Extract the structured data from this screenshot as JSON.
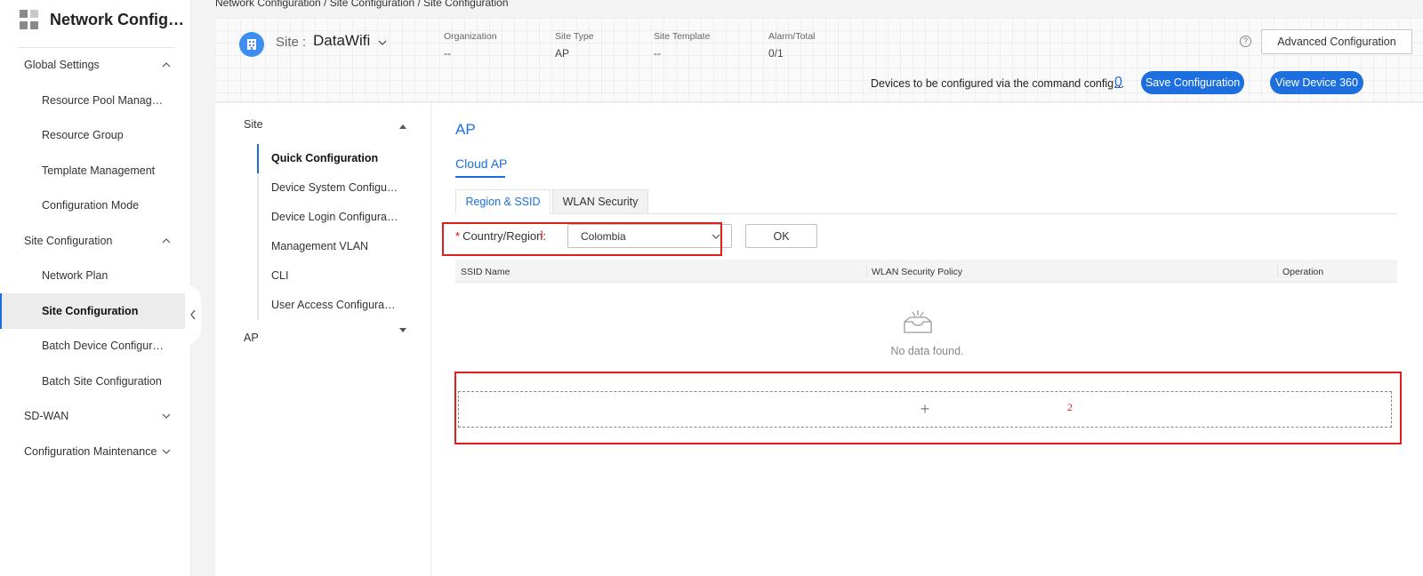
{
  "sidebar": {
    "title": "Network Config…",
    "items": [
      {
        "label": "Global Settings"
      },
      {
        "label": "Resource Pool Manag…"
      },
      {
        "label": "Resource Group"
      },
      {
        "label": "Template Management"
      },
      {
        "label": "Configuration Mode"
      },
      {
        "label": "Site Configuration"
      },
      {
        "label": "Network Plan"
      },
      {
        "label": "Site Configuration"
      },
      {
        "label": "Batch Device Configur…"
      },
      {
        "label": "Batch Site Configuration"
      },
      {
        "label": "SD-WAN"
      },
      {
        "label": "Configuration Maintenance"
      }
    ]
  },
  "breadcrumb": "Network Configuration / Site Configuration / Site Configuration",
  "header": {
    "site_label": "Site :",
    "site_name": "DataWifi",
    "info": [
      {
        "label": "Organization",
        "value": "--"
      },
      {
        "label": "Site Type",
        "value": "AP"
      },
      {
        "label": "Site Template",
        "value": "--"
      },
      {
        "label": "Alarm/Total",
        "value": "0/1"
      }
    ],
    "help_icon": "?",
    "advanced_btn": "Advanced Configuration",
    "pending_text": "Devices to be configured via the command config…",
    "pending_count": "0",
    "save_btn": "Save Configuration",
    "view_btn": "View Device 360"
  },
  "tree": {
    "site": "Site",
    "items": [
      {
        "label": "Quick Configuration"
      },
      {
        "label": "Device System Configu…"
      },
      {
        "label": "Device Login Configura…"
      },
      {
        "label": "Management VLAN"
      },
      {
        "label": "CLI"
      },
      {
        "label": "User Access Configura…"
      }
    ],
    "ap": "AP"
  },
  "main": {
    "title": "AP",
    "cloud_ap": "Cloud AP",
    "tabs": [
      {
        "label": "Region & SSID"
      },
      {
        "label": "WLAN Security"
      }
    ],
    "required_mark": "*",
    "country_label": "Country/Region:",
    "country_value": "Colombia",
    "ok_btn": "OK",
    "columns": [
      "SSID Name",
      "WLAN Security Policy",
      "Operation"
    ],
    "empty_text": "No data found.",
    "add_symbol": "+"
  },
  "annotations": [
    {
      "number": "1"
    },
    {
      "number": "2"
    }
  ],
  "colors": {
    "accent": "#1d6fe0",
    "annotation": "#e21d1d"
  }
}
